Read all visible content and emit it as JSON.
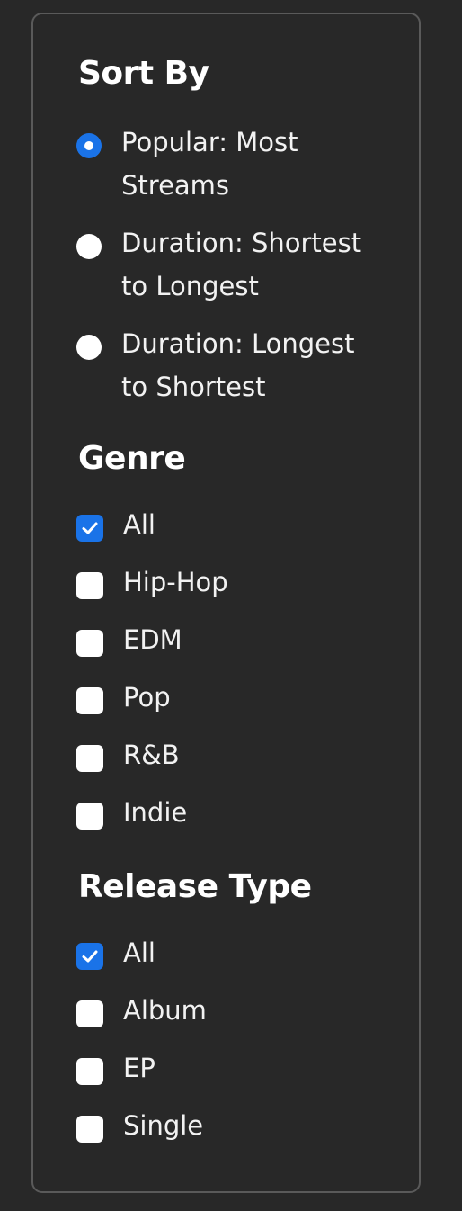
{
  "sort": {
    "title": "Sort By",
    "options": [
      {
        "label": "Popular: Most Streams",
        "checked": true
      },
      {
        "label": "Duration: Shortest to Longest",
        "checked": false
      },
      {
        "label": "Duration: Longest to Shortest",
        "checked": false
      }
    ]
  },
  "genre": {
    "title": "Genre",
    "options": [
      {
        "label": "All",
        "checked": true
      },
      {
        "label": "Hip-Hop",
        "checked": false
      },
      {
        "label": "EDM",
        "checked": false
      },
      {
        "label": "Pop",
        "checked": false
      },
      {
        "label": "R&B",
        "checked": false
      },
      {
        "label": "Indie",
        "checked": false
      }
    ]
  },
  "release_type": {
    "title": "Release Type",
    "options": [
      {
        "label": "All",
        "checked": true
      },
      {
        "label": "Album",
        "checked": false
      },
      {
        "label": "EP",
        "checked": false
      },
      {
        "label": "Single",
        "checked": false
      }
    ]
  },
  "colors": {
    "background": "#282828",
    "panel_border": "#5a5a5a",
    "accent": "#1a73e8",
    "text": "#ffffff"
  }
}
